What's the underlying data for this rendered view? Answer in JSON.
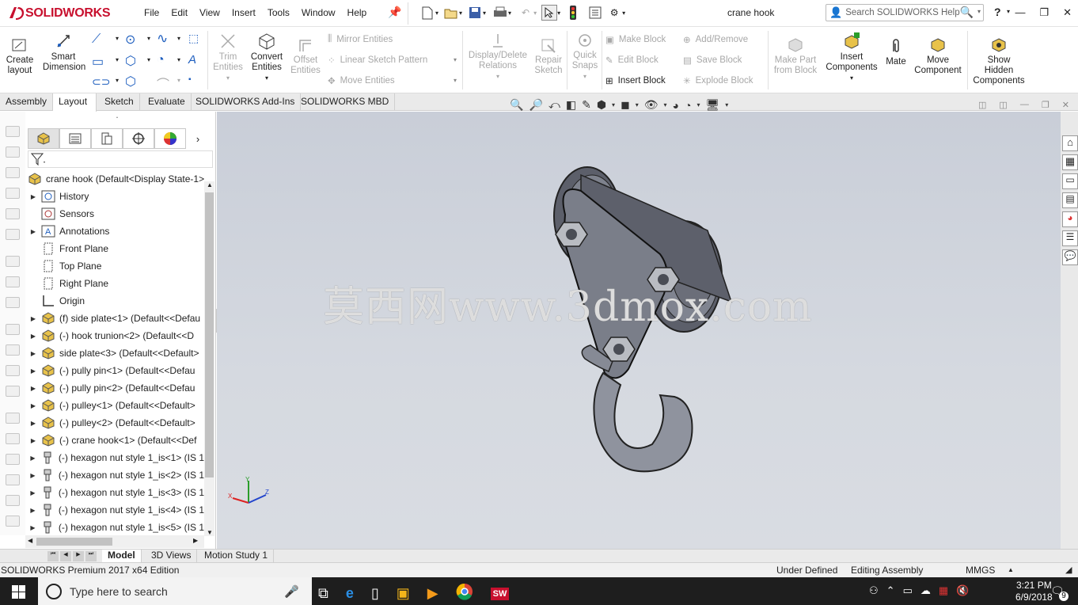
{
  "app": {
    "brand": "SOLIDWORKS",
    "document_title": "crane hook",
    "menus": [
      "File",
      "Edit",
      "View",
      "Insert",
      "Tools",
      "Window",
      "Help"
    ],
    "search_placeholder": "Search SOLIDWORKS Help"
  },
  "ribbon": {
    "create_layout": "Create\nlayout",
    "smart_dimension": "Smart\nDimension",
    "trim_entities": "Trim\nEntities",
    "convert_entities": "Convert\nEntities",
    "offset_entities": "Offset\nEntities",
    "mirror_entities": "Mirror Entities",
    "linear_sketch_pattern": "Linear Sketch Pattern",
    "move_entities": "Move Entities",
    "display_delete_relations": "Display/Delete\nRelations",
    "repair_sketch": "Repair\nSketch",
    "quick_snaps": "Quick\nSnaps",
    "make_block": "Make Block",
    "edit_block": "Edit Block",
    "insert_block": "Insert Block",
    "add_remove": "Add/Remove",
    "save_block": "Save Block",
    "explode_block": "Explode Block",
    "make_part_from_block": "Make Part\nfrom Block",
    "insert_components": "Insert\nComponents",
    "mate": "Mate",
    "move_component": "Move\nComponent",
    "show_hidden_components": "Show\nHidden\nComponents"
  },
  "command_tabs": [
    "Assembly",
    "Layout",
    "Sketch",
    "Evaluate",
    "SOLIDWORKS Add-Ins",
    "SOLIDWORKS MBD"
  ],
  "active_command_tab": "Layout",
  "feature_tree": {
    "root": "crane hook  (Default<Display State-1>",
    "items": [
      {
        "label": "History",
        "icon": "history-icon",
        "expandable": true
      },
      {
        "label": "Sensors",
        "icon": "sensors-icon",
        "expandable": false
      },
      {
        "label": "Annotations",
        "icon": "annotations-icon",
        "expandable": true
      },
      {
        "label": "Front Plane",
        "icon": "plane-icon",
        "expandable": false
      },
      {
        "label": "Top Plane",
        "icon": "plane-icon",
        "expandable": false
      },
      {
        "label": "Right Plane",
        "icon": "plane-icon",
        "expandable": false
      },
      {
        "label": "Origin",
        "icon": "origin-icon",
        "expandable": false
      },
      {
        "label": "(f) side plate<1> (Default<<Defau",
        "icon": "part-icon",
        "expandable": true
      },
      {
        "label": "(-) hook trunion<2> (Default<<D",
        "icon": "part-icon",
        "expandable": true
      },
      {
        "label": "side plate<3> (Default<<Default>",
        "icon": "part-icon",
        "expandable": true
      },
      {
        "label": "(-) pully pin<1> (Default<<Defau",
        "icon": "part-icon",
        "expandable": true
      },
      {
        "label": "(-) pully pin<2> (Default<<Defau",
        "icon": "part-icon",
        "expandable": true
      },
      {
        "label": "(-) pulley<1> (Default<<Default>",
        "icon": "part-icon",
        "expandable": true
      },
      {
        "label": "(-) pulley<2> (Default<<Default>",
        "icon": "part-icon",
        "expandable": true
      },
      {
        "label": "(-) crane hook<1> (Default<<Def",
        "icon": "part-icon",
        "expandable": true
      },
      {
        "label": "(-) hexagon nut style 1_is<1> (IS 1",
        "icon": "toolbox-part-icon",
        "expandable": true
      },
      {
        "label": "(-) hexagon nut style 1_is<2> (IS 1",
        "icon": "toolbox-part-icon",
        "expandable": true
      },
      {
        "label": "(-) hexagon nut style 1_is<3> (IS 1",
        "icon": "toolbox-part-icon",
        "expandable": true
      },
      {
        "label": "(-) hexagon nut style 1_is<4> (IS 1",
        "icon": "toolbox-part-icon",
        "expandable": true
      },
      {
        "label": "(-) hexagon nut style 1_is<5> (IS 1",
        "icon": "toolbox-part-icon",
        "expandable": true
      }
    ]
  },
  "watermark": "莫西网www.3dmox.com",
  "bottom_tabs": [
    "Model",
    "3D Views",
    "Motion Study 1"
  ],
  "active_bottom_tab": "Model",
  "status_bar": {
    "edition": "SOLIDWORKS Premium 2017 x64 Edition",
    "state": "Under Defined",
    "mode": "Editing Assembly",
    "units": "MMGS"
  },
  "taskbar": {
    "search_placeholder": "Type here to search",
    "time": "3:21 PM",
    "date": "6/9/2018",
    "notification_count": "9"
  }
}
